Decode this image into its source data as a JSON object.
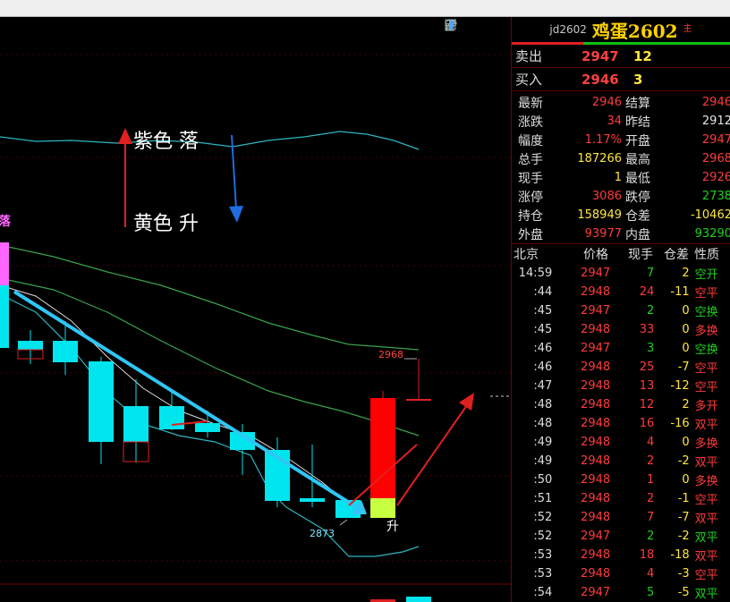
{
  "header": {
    "code": "jd2602",
    "name": "鸡蛋2602",
    "main_marker": "主"
  },
  "chart": {
    "annotations": {
      "purple_label": "紫色 落",
      "yellow_label": "黄色 升",
      "left_marker": "落",
      "rise_marker": "升",
      "high_label": "2968",
      "low_label": "2873"
    },
    "tool_icons": [
      "eye-icon",
      "pencil-icon",
      "grid-icon",
      "layout-icon"
    ]
  },
  "orderbook": {
    "sell": {
      "label": "卖出",
      "price": "2947",
      "volume": "12"
    },
    "buy": {
      "label": "买入",
      "price": "2946",
      "volume": "3"
    }
  },
  "stats": [
    {
      "l1": "最新",
      "v1": "2946",
      "c1": "red",
      "l2": "结算",
      "v2": "2946",
      "c2": "red"
    },
    {
      "l1": "涨跌",
      "v1": "34",
      "c1": "red",
      "l2": "昨结",
      "v2": "2912",
      "c2": "white"
    },
    {
      "l1": "幅度",
      "v1": "1.17%",
      "c1": "red",
      "l2": "开盘",
      "v2": "2947",
      "c2": "red"
    },
    {
      "l1": "总手",
      "v1": "187266",
      "c1": "yellow",
      "l2": "最高",
      "v2": "2968",
      "c2": "red"
    },
    {
      "l1": "现手",
      "v1": "1",
      "c1": "yellow",
      "l2": "最低",
      "v2": "2926",
      "c2": "red"
    },
    {
      "l1": "涨停",
      "v1": "3086",
      "c1": "red",
      "l2": "跌停",
      "v2": "2738",
      "c2": "green"
    },
    {
      "l1": "持仓",
      "v1": "158949",
      "c1": "yellow",
      "l2": "仓差",
      "v2": "-10462",
      "c2": "yellow"
    },
    {
      "l1": "外盘",
      "v1": "93977",
      "c1": "red",
      "l2": "内盘",
      "v2": "93290",
      "c2": "green"
    }
  ],
  "trades": {
    "headers": {
      "time": "北京",
      "price": "价格",
      "volume": "现手",
      "diff": "仓差",
      "nature": "性质"
    },
    "rows": [
      {
        "time": "14:59",
        "price": "2947",
        "vol": "7",
        "diff": "2",
        "nature": "空开",
        "nc": "green"
      },
      {
        "time": ":44",
        "price": "2948",
        "vol": "24",
        "diff": "-11",
        "nature": "空平",
        "nc": "red"
      },
      {
        "time": ":45",
        "price": "2947",
        "vol": "2",
        "diff": "0",
        "nature": "空换",
        "nc": "green"
      },
      {
        "time": ":45",
        "price": "2948",
        "vol": "33",
        "diff": "0",
        "nature": "多换",
        "nc": "red"
      },
      {
        "time": ":46",
        "price": "2947",
        "vol": "3",
        "diff": "0",
        "nature": "空换",
        "nc": "green"
      },
      {
        "time": ":46",
        "price": "2948",
        "vol": "25",
        "diff": "-7",
        "nature": "空平",
        "nc": "red"
      },
      {
        "time": ":47",
        "price": "2948",
        "vol": "13",
        "diff": "-12",
        "nature": "空平",
        "nc": "red"
      },
      {
        "time": ":48",
        "price": "2948",
        "vol": "12",
        "diff": "2",
        "nature": "多开",
        "nc": "red"
      },
      {
        "time": ":48",
        "price": "2948",
        "vol": "16",
        "diff": "-16",
        "nature": "双平",
        "nc": "red"
      },
      {
        "time": ":49",
        "price": "2948",
        "vol": "4",
        "diff": "0",
        "nature": "多换",
        "nc": "red"
      },
      {
        "time": ":49",
        "price": "2948",
        "vol": "2",
        "diff": "-2",
        "nature": "双平",
        "nc": "red"
      },
      {
        "time": ":50",
        "price": "2948",
        "vol": "1",
        "diff": "0",
        "nature": "多换",
        "nc": "red"
      },
      {
        "time": ":51",
        "price": "2948",
        "vol": "2",
        "diff": "-1",
        "nature": "空平",
        "nc": "red"
      },
      {
        "time": ":52",
        "price": "2948",
        "vol": "7",
        "diff": "-7",
        "nature": "双平",
        "nc": "red"
      },
      {
        "time": ":52",
        "price": "2947",
        "vol": "2",
        "diff": "-2",
        "nature": "双平",
        "nc": "green"
      },
      {
        "time": ":53",
        "price": "2948",
        "vol": "18",
        "diff": "-18",
        "nature": "双平",
        "nc": "red"
      },
      {
        "time": ":53",
        "price": "2948",
        "vol": "4",
        "diff": "-3",
        "nature": "空平",
        "nc": "red"
      },
      {
        "time": ":54",
        "price": "2947",
        "vol": "5",
        "diff": "-5",
        "nature": "双平",
        "nc": "green"
      }
    ]
  }
}
